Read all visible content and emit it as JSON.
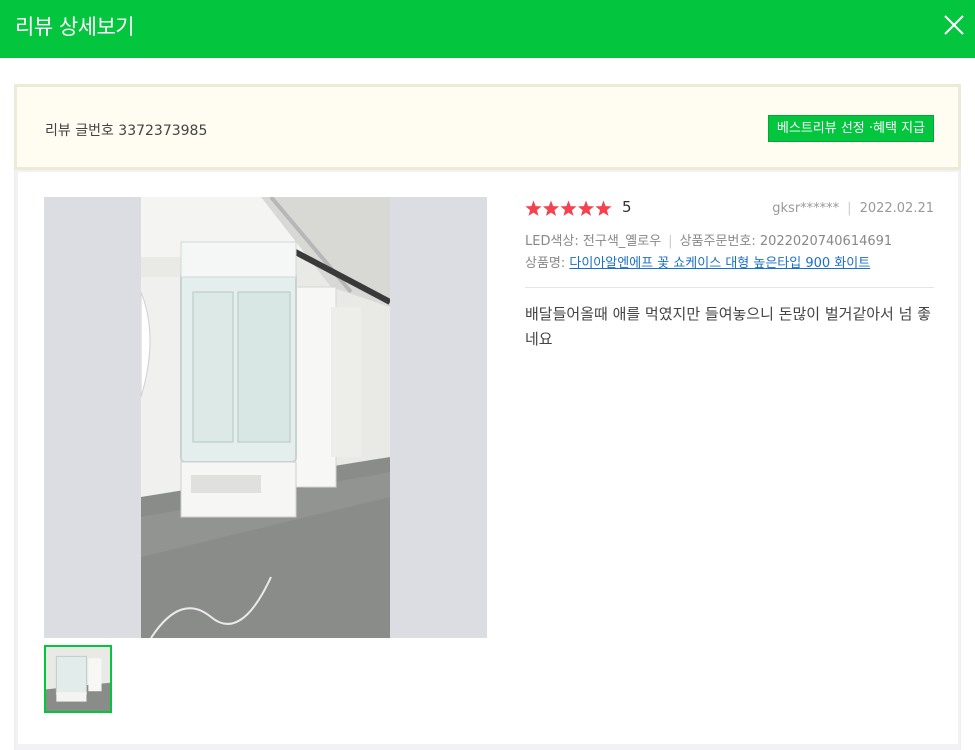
{
  "header": {
    "title": "리뷰 상세보기",
    "close_icon": "close-icon"
  },
  "info": {
    "review_number_label": "리뷰 글번호 3372373985",
    "best_review_button": "베스트리뷰 선정 ·혜택 지급"
  },
  "review": {
    "stars": 5,
    "score": "5",
    "author": "gksr******",
    "date": "2022.02.21",
    "option_label": "LED색상: 전구색_옐로우",
    "order_label": "상품주문번호: 2022020740614691",
    "product_prefix": "상품명:",
    "product_name": "다이아알엔에프 꽃 쇼케이스 대형 높은타입 900 화이트",
    "text": "배달들어올때 애를 먹였지만 들여놓으니 돈많이 벌거같아서 넘 좋네요"
  },
  "colors": {
    "brand": "#03c53e",
    "star": "#f5424f",
    "link": "#1a6fc9"
  }
}
